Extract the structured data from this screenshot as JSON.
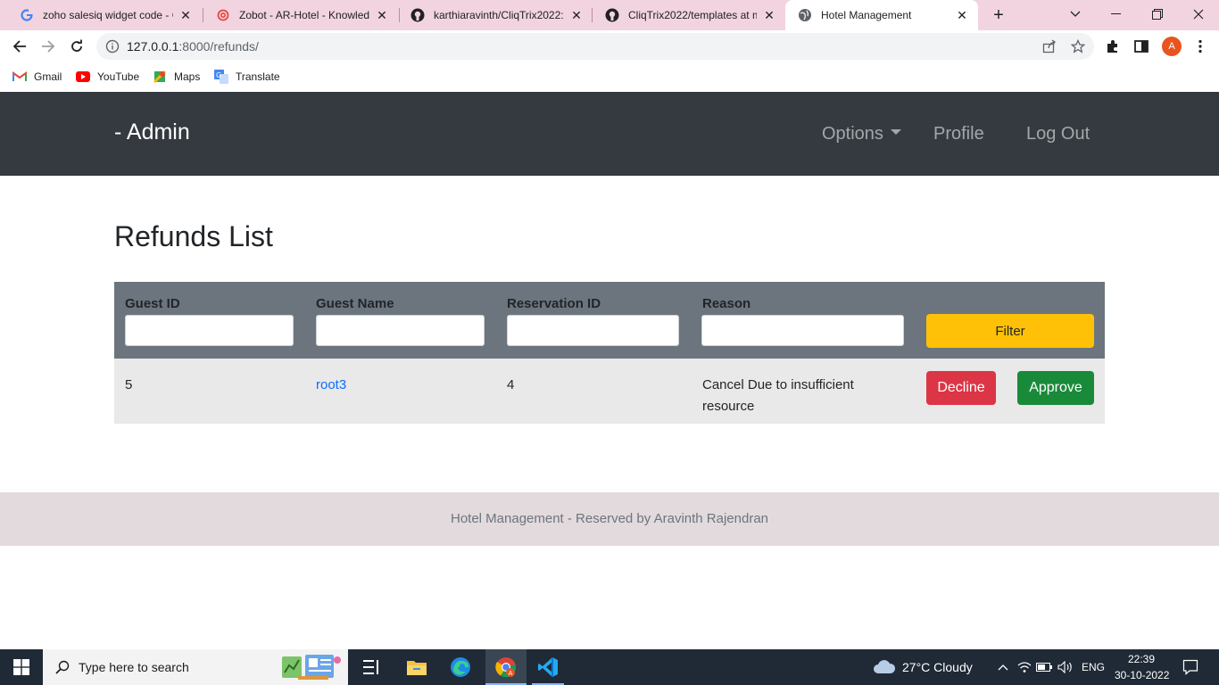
{
  "browser": {
    "tabs": [
      {
        "title": "zoho salesiq widget code - G",
        "favicon": "google-icon",
        "active": false
      },
      {
        "title": "Zobot - AR-Hotel - Knowledg",
        "favicon": "salesiq-icon",
        "active": false
      },
      {
        "title": "karthiaravinth/CliqTrix2022: C",
        "favicon": "github-icon",
        "active": false
      },
      {
        "title": "CliqTrix2022/templates at ma",
        "favicon": "github-icon",
        "active": false
      },
      {
        "title": "Hotel Management",
        "favicon": "globe-icon",
        "active": true
      }
    ],
    "url_host": "127.0.0.1",
    "url_path": ":8000/refunds/",
    "profile_initial": "A",
    "bookmarks": [
      {
        "label": "Gmail",
        "icon": "gmail-icon"
      },
      {
        "label": "YouTube",
        "icon": "youtube-icon"
      },
      {
        "label": "Maps",
        "icon": "maps-icon"
      },
      {
        "label": "Translate",
        "icon": "translate-icon"
      }
    ]
  },
  "navbar": {
    "brand": "- Admin",
    "links": {
      "options": "Options",
      "profile": "Profile",
      "logout": "Log Out"
    }
  },
  "page": {
    "title": "Refunds List"
  },
  "table": {
    "headers": {
      "guest_id": "Guest ID",
      "guest_name": "Guest Name",
      "reservation_id": "Reservation ID",
      "reason": "Reason"
    },
    "filter_values": {
      "guest_id": "",
      "guest_name": "",
      "reservation_id": "",
      "reason": ""
    },
    "filter_label": "Filter",
    "rows": [
      {
        "guest_id": "5",
        "guest_name": "root3",
        "reservation_id": "4",
        "reason_line1": "Cancel Due to insufficient",
        "reason_line2": "resource",
        "decline_label": "Decline",
        "approve_label": "Approve"
      }
    ]
  },
  "footer": {
    "text": "Hotel Management - Reserved by Aravinth Rajendran"
  },
  "taskbar": {
    "search_placeholder": "Type here to search",
    "weather": "27°C  Cloudy",
    "language": "ENG",
    "time": "22:39",
    "date": "30-10-2022"
  },
  "colors": {
    "navbar_bg": "#343a40",
    "table_head_bg": "#6c757d",
    "filter_btn": "#ffc107",
    "decline_btn": "#dc3545",
    "approve_btn": "#198a3a",
    "footer_bg": "#e3dadd"
  }
}
